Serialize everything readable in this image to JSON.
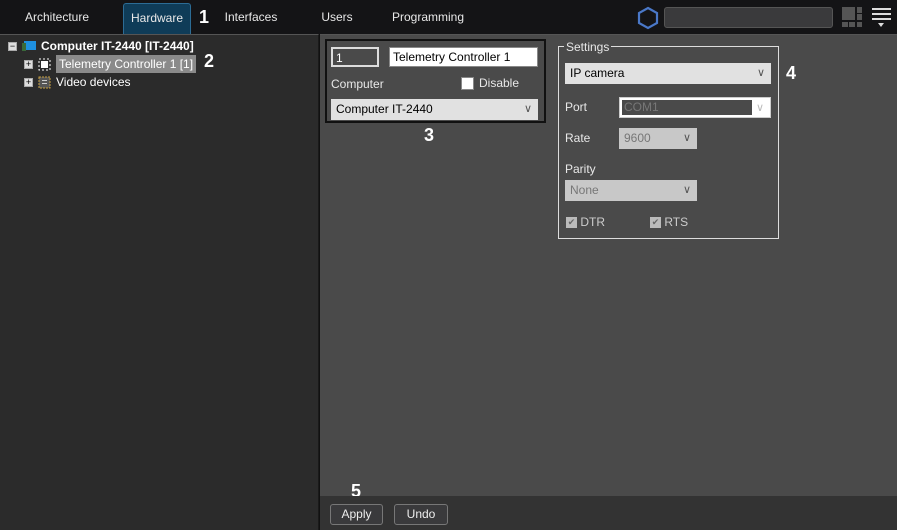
{
  "tabs": [
    {
      "label": "Architecture"
    },
    {
      "label": "Hardware"
    },
    {
      "label": "Interfaces"
    },
    {
      "label": "Users"
    },
    {
      "label": "Programming"
    }
  ],
  "markers": [
    "1",
    "2",
    "3",
    "4",
    "5"
  ],
  "tree": {
    "root": "Computer IT-2440 [IT-2440]",
    "children": [
      {
        "label": "Telemetry Controller 1 [1]"
      },
      {
        "label": "Video devices"
      }
    ]
  },
  "device": {
    "id": "1",
    "name": "Telemetry Controller 1",
    "computer_label": "Computer",
    "disable_label": "Disable",
    "computer_value": "Computer IT-2440"
  },
  "settings": {
    "title": "Settings",
    "type_value": "IP camera",
    "port_label": "Port",
    "port_value": "COM1",
    "rate_label": "Rate",
    "rate_value": "9600",
    "parity_label": "Parity",
    "parity_value": "None",
    "dtr_label": "DTR",
    "rts_label": "RTS"
  },
  "buttons": {
    "apply": "Apply",
    "undo": "Undo"
  }
}
